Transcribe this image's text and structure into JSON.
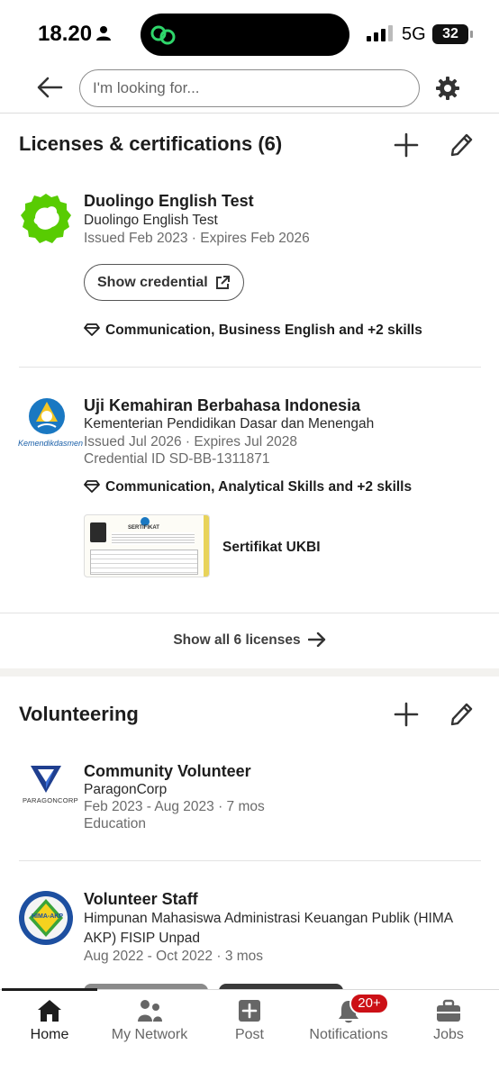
{
  "status_bar": {
    "time": "18.20",
    "network": "5G",
    "battery": "32"
  },
  "search": {
    "placeholder": "I'm looking for..."
  },
  "licenses": {
    "title": "Licenses & certifications (6)",
    "items": [
      {
        "title": "Duolingo English Test",
        "issuer": "Duolingo English Test",
        "dates": "Issued Feb 2023 · Expires Feb 2026",
        "button": "Show credential",
        "skills": "Communication, Business English and +2 skills"
      },
      {
        "title": "Uji Kemahiran Berbahasa Indonesia",
        "issuer": "Kementerian Pendidikan Dasar dan Menengah",
        "dates": "Issued Jul 2026 · Expires Jul 2028",
        "credential_id": "Credential ID SD-BB-1311871",
        "skills": "Communication, Analytical Skills and +2 skills",
        "logo_text": "Kemendikdasmen",
        "media": {
          "label": "Sertifikat UKBI",
          "doc_heading": "SERTIFIKAT"
        }
      }
    ],
    "show_all": "Show all 6 licenses"
  },
  "volunteering": {
    "title": "Volunteering",
    "items": [
      {
        "title": "Community Volunteer",
        "org": "ParagonCorp",
        "dates": "Feb 2023 - Aug 2023 · 7 mos",
        "cause": "Education",
        "logo_text": "PARAGONCORP"
      },
      {
        "title": "Volunteer Staff",
        "org_line1": "Himpunan Mahasiswa Administrasi Keuangan Publik (HIMA",
        "org_line2": "AKP) FISIP Unpad",
        "dates": "Aug 2022 - Oct 2022 · 3 mos",
        "logo_text": "HIMA-AKP"
      }
    ]
  },
  "bottom_nav": {
    "items": [
      {
        "label": "Home",
        "icon": "home-icon"
      },
      {
        "label": "My Network",
        "icon": "network-icon"
      },
      {
        "label": "Post",
        "icon": "post-icon"
      },
      {
        "label": "Notifications",
        "icon": "bell-icon",
        "badge": "20+"
      },
      {
        "label": "Jobs",
        "icon": "briefcase-icon"
      }
    ]
  },
  "colors": {
    "duolingo_green": "#58cc02",
    "badge_red": "#cc1016",
    "paragon_blue": "#1f3f8f"
  }
}
